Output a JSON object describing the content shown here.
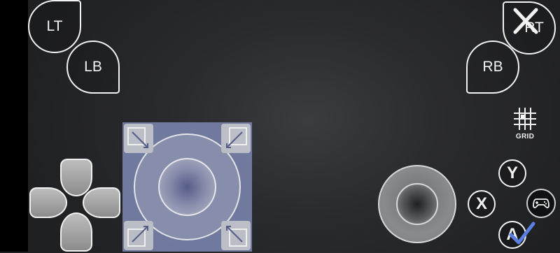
{
  "buttons": {
    "lt": "LT",
    "lb": "LB",
    "rt": "RT",
    "rb": "RB",
    "y": "Y",
    "x": "X",
    "a": "A"
  },
  "grid": {
    "label": "GRID"
  },
  "icons": [
    "close-icon",
    "grid-icon",
    "gamepad-icon",
    "check-icon",
    "resize-arrow-icon"
  ],
  "colors": {
    "panel": "#7781a8",
    "outline": "#f2f2f2",
    "check": "#5b7fe0"
  }
}
